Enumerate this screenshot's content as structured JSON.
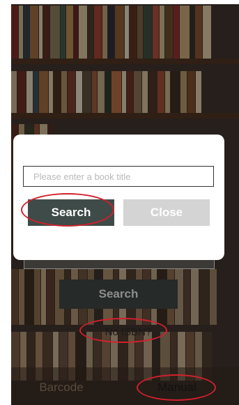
{
  "modal": {
    "title_input_placeholder": "Please enter a book title",
    "search_label": "Search",
    "close_label": "Close"
  },
  "background_screen": {
    "search_label": "Search",
    "no_isbn_label": "No ISBN?"
  },
  "tabs": {
    "barcode_label": "Barcode",
    "manual_label": "Manual"
  },
  "colors": {
    "search_button": "#3f4b48",
    "close_button": "#d4d4d4",
    "annotation_ring": "#d3202c"
  }
}
